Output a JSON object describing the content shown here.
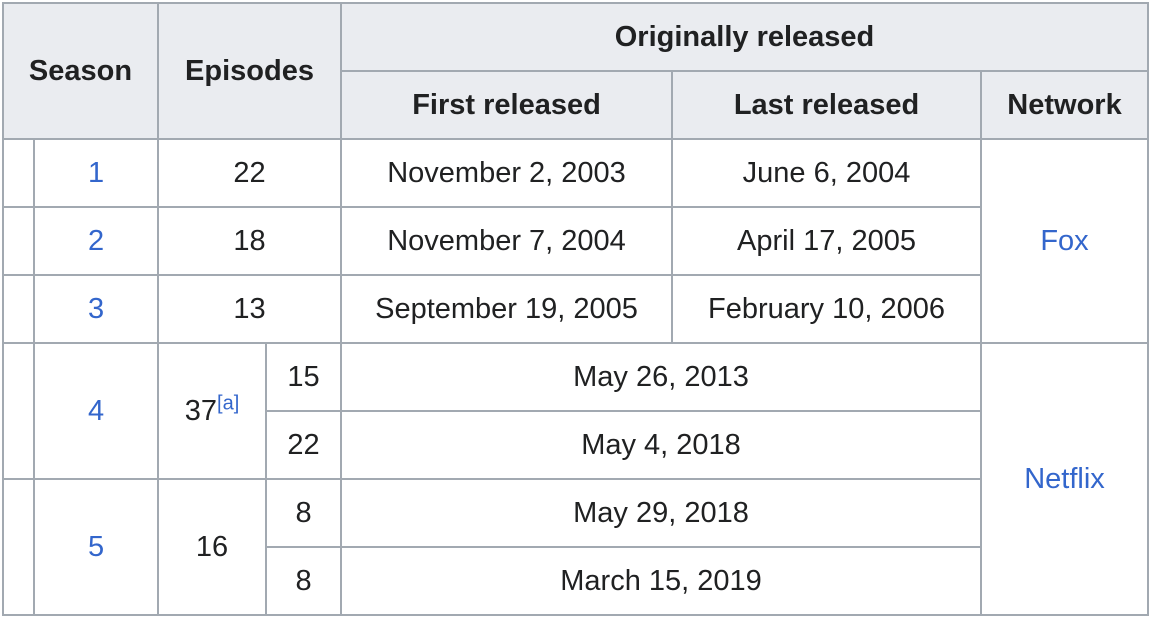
{
  "header": {
    "season": "Season",
    "episodes": "Episodes",
    "originally_released": "Originally released",
    "first_released": "First released",
    "last_released": "Last released",
    "network": "Network"
  },
  "rows": [
    {
      "season": "1",
      "episodes": "22",
      "first": "November 2, 2003",
      "last": "June 6, 2004"
    },
    {
      "season": "2",
      "episodes": "18",
      "first": "November 7, 2004",
      "last": "April 17, 2005"
    },
    {
      "season": "3",
      "episodes": "13",
      "first": "September 19, 2005",
      "last": "February 10, 2006"
    }
  ],
  "season4": {
    "season": "4",
    "episodes": "37",
    "footnote": "[a]",
    "parts": [
      {
        "episodes": "15",
        "release": "May 26, 2013"
      },
      {
        "episodes": "22",
        "release": "May 4, 2018"
      }
    ]
  },
  "season5": {
    "season": "5",
    "episodes": "16",
    "parts": [
      {
        "episodes": "8",
        "release": "May 29, 2018"
      },
      {
        "episodes": "8",
        "release": "March 15, 2019"
      }
    ]
  },
  "networks": {
    "fox": "Fox",
    "netflix": "Netflix"
  },
  "colors": {
    "header_bg": "#eaecf0",
    "border": "#a2a9b1",
    "link": "#3366cc",
    "text": "#202122"
  }
}
